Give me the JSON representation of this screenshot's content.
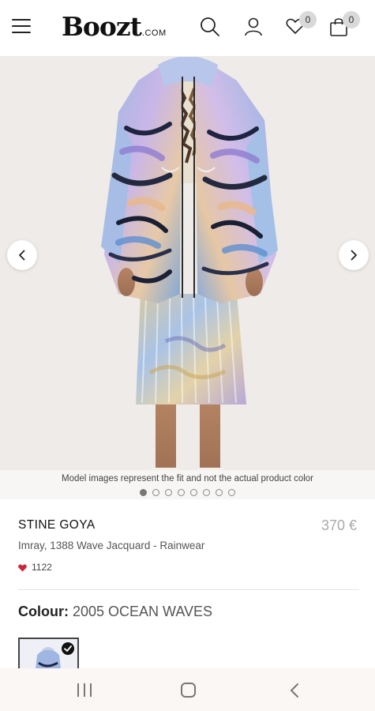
{
  "header": {
    "logo_main": "Boozt",
    "logo_suffix": ".COM",
    "wishlist_count": "0",
    "cart_count": "0"
  },
  "hero": {
    "caption": "Model images represent the fit and not the actual product color",
    "carousel": {
      "total": 8,
      "active": 1
    }
  },
  "product": {
    "brand": "STINE GOYA",
    "price": "370 €",
    "name": "Imray, 1388 Wave Jacquard - Rainwear",
    "likes": "1122",
    "colour_label": "Colour:",
    "colour_value": "2005 OCEAN WAVES"
  },
  "icons": {
    "menu": "hamburger-icon",
    "search": "search-icon",
    "account": "user-icon",
    "wishlist": "heart-icon",
    "cart": "shopping-bag-icon",
    "prev": "chevron-left-icon",
    "next": "chevron-right-icon",
    "selected": "checkmark-icon"
  },
  "colors": {
    "hero_background": "#efebe8",
    "likes_heart": "#d0243a",
    "price": "#aaaaaa",
    "badge": "#d9d9d9"
  }
}
